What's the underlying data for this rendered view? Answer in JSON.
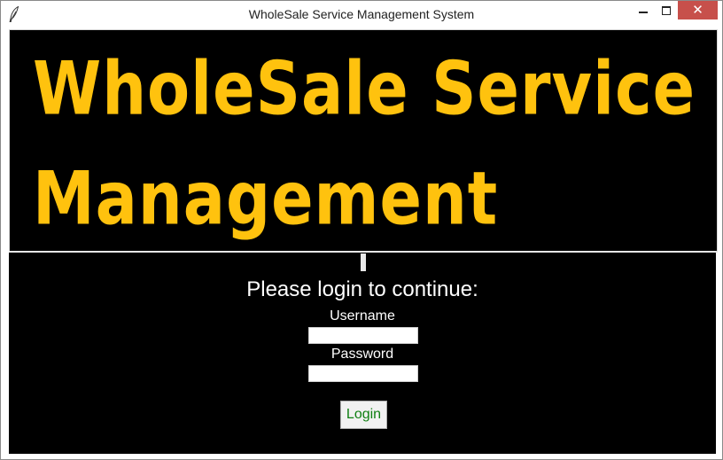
{
  "window": {
    "title": "WholeSale Service Management System",
    "icon": "feather-icon",
    "controls": [
      "minimize-icon",
      "maximize-icon",
      "close-icon"
    ],
    "close_glyph": "✕"
  },
  "banner": {
    "line1": "WholeSale Service",
    "line2": "Management",
    "text_color": "#ffc20e",
    "background": "#000000"
  },
  "login": {
    "prompt": "Please login to continue:",
    "username_label": "Username",
    "username_value": "",
    "password_label": "Password",
    "password_value": "",
    "button_label": "Login",
    "button_text_color": "#0f7f12"
  }
}
